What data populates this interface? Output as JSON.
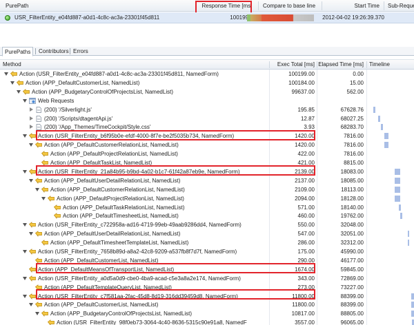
{
  "purepath_header": {
    "col_purepath": "PurePath",
    "col_response_time": "Response Time [ms]",
    "col_compare": "Compare to base line",
    "col_start_time": "Start Time",
    "col_sub_requests": "Sub-Reque"
  },
  "purepath_row": {
    "name": "USR_FilterEntity_e04fd887-a0d1-4c8c-ac3a-23301f45d811",
    "response_time": "100199",
    "start_time": "2012-04-02 19:26:39.370"
  },
  "tabs": [
    {
      "label": "PurePaths"
    },
    {
      "label": "Contributors"
    },
    {
      "label": "Errors"
    }
  ],
  "tree_header": {
    "col_method": "Method",
    "col_exec_total": "Exec Total [ms]",
    "col_elapsed": "Elapsed Time [ms]",
    "col_timeline": "Timeline"
  },
  "rows": [
    {
      "label": "Action (USR_FilterEntity_e04fd887-a0d1-4c8c-ac3a-23301f45d811, NamedForm)",
      "exec": "100199.00",
      "elapsed": "0.00",
      "icon": "action-icon",
      "twisty": "open"
    },
    {
      "label": "Action (APP_DefaultCustomerList, NamedList)",
      "exec": "100184.00",
      "elapsed": "15.00",
      "icon": "action-icon",
      "twisty": "open"
    },
    {
      "label": "Action (APP_BudgetaryControlOfProjectsList, NamedList)",
      "exec": "99637.00",
      "elapsed": "562.00",
      "icon": "action-icon",
      "twisty": "open"
    },
    {
      "label": "Web Requests",
      "exec": "",
      "elapsed": "",
      "icon": "web-requests-icon",
      "twisty": "open"
    },
    {
      "label": "(200) '/Silverlight.js'",
      "exec": "195.85",
      "elapsed": "67628.76",
      "icon": "page-icon",
      "twisty": "closed"
    },
    {
      "label": "(200) '/Scripts/dtagentApi.js'",
      "exec": "12.87",
      "elapsed": "68027.25",
      "icon": "page-icon",
      "twisty": "closed"
    },
    {
      "label": "(200) '/App_Themes/TimeCockpit/Style.css'",
      "exec": "3.93",
      "elapsed": "68283.70",
      "icon": "page-icon",
      "twisty": "closed"
    },
    {
      "label": "Action (USR_FilterEntity_b6f95b0e-efdf-4000-8f7e-be2f5035b734, NamedForm)",
      "exec": "1420.00",
      "elapsed": "7816.00",
      "icon": "action-icon",
      "twisty": "open"
    },
    {
      "label": "Action (APP_DefaultCustomerRelationList, NamedList)",
      "exec": "1420.00",
      "elapsed": "7816.00",
      "icon": "action-icon",
      "twisty": "open"
    },
    {
      "label": "Action (APP_DefaultProjectRelationList, NamedList)",
      "exec": "422.00",
      "elapsed": "7816.00",
      "icon": "action-icon",
      "twisty": ""
    },
    {
      "label": "Action (APP_DefaultTaskList, NamedList)",
      "exec": "421.00",
      "elapsed": "8815.00",
      "icon": "action-icon",
      "twisty": ""
    },
    {
      "label": "Action (USR_FilterEntity_21a84b95-b9bd-4a02-b1c7-61f42a87eb9e, NamedForm)",
      "exec": "2139.00",
      "elapsed": "18083.00",
      "icon": "action-icon",
      "twisty": "open"
    },
    {
      "label": "Action (APP_DefaultUserDetailRelationList, NamedList)",
      "exec": "2137.00",
      "elapsed": "18085.00",
      "icon": "action-icon",
      "twisty": "open"
    },
    {
      "label": "Action (APP_DefaultCustomerRelationList, NamedList)",
      "exec": "2109.00",
      "elapsed": "18113.00",
      "icon": "action-icon",
      "twisty": "open"
    },
    {
      "label": "Action (APP_DefaultProjectRelationList, NamedList)",
      "exec": "2094.00",
      "elapsed": "18128.00",
      "icon": "action-icon",
      "twisty": "open"
    },
    {
      "label": "Action (APP_DefaultTaskRelationList, NamedList)",
      "exec": "571.00",
      "elapsed": "18140.00",
      "icon": "action-icon",
      "twisty": ""
    },
    {
      "label": "Action (APP_DefaultTimesheetList, NamedList)",
      "exec": "460.00",
      "elapsed": "19762.00",
      "icon": "action-icon",
      "twisty": ""
    },
    {
      "label": "Action (USR_FilterEntity_c722958a-ad16-4719-99eb-49aab9286dd4, NamedForm)",
      "exec": "550.00",
      "elapsed": "32048.00",
      "icon": "action-icon",
      "twisty": "open"
    },
    {
      "label": "Action (APP_DefaultUserDetailRelationList, NamedList)",
      "exec": "547.00",
      "elapsed": "32051.00",
      "icon": "action-icon",
      "twisty": "open"
    },
    {
      "label": "Action (APP_DefaultTimesheetTemplateList, NamedList)",
      "exec": "286.00",
      "elapsed": "32312.00",
      "icon": "action-icon",
      "twisty": ""
    },
    {
      "label": "Action (USR_FilterEntity_7658b89d-a8a2-42c8-9209-a537fb8f7d7f, NamedForm)",
      "exec": "175.00",
      "elapsed": "45990.00",
      "icon": "action-icon",
      "twisty": "open"
    },
    {
      "label": "Action (APP_DefaultCustomerList, NamedList)",
      "exec": "290.00",
      "elapsed": "46177.00",
      "icon": "action-icon",
      "twisty": ""
    },
    {
      "label": "Action (APP_DefaultMeansOfTransportList, NamedList)",
      "exec": "1674.00",
      "elapsed": "59845.00",
      "icon": "action-icon",
      "twisty": ""
    },
    {
      "label": "Action (USR_FilterEntity_a0d5a0d9-cbe0-4ba9-acad-c5e3a8a2e174, NamedForm)",
      "exec": "343.00",
      "elapsed": "72869.00",
      "icon": "action-icon",
      "twisty": "open"
    },
    {
      "label": "Action (APP_DefaultTemplateQueryList, NamedList)",
      "exec": "273.00",
      "elapsed": "73227.00",
      "icon": "action-icon",
      "twisty": ""
    },
    {
      "label": "Action (USR_FilterEntity_c7f581aa-2fac-45d8-8d19-316dd39459d8, NamedForm)",
      "exec": "11800.00",
      "elapsed": "88399.00",
      "icon": "action-icon",
      "twisty": "open"
    },
    {
      "label": "Action (APP_DefaultCustomerList, NamedList)",
      "exec": "11800.00",
      "elapsed": "88399.00",
      "icon": "action-icon",
      "twisty": "open"
    },
    {
      "label": "Action (APP_BudgetaryControlOfProjectsList, NamedList)",
      "exec": "10817.00",
      "elapsed": "88805.00",
      "icon": "action-icon",
      "twisty": "open"
    },
    {
      "label": "Action (USR_FilterEntity_98f0eb73-3064-4c40-8636-5315c90e91a8, NamedF",
      "exec": "3557.00",
      "elapsed": "96065.00",
      "icon": "action-icon",
      "twisty": ""
    }
  ],
  "colors": {
    "highlight_box": "#e2232a",
    "selected_row": "#dfe9f7",
    "status_ok": "#2f9a18",
    "timeline_bar": "#a9bee6"
  }
}
